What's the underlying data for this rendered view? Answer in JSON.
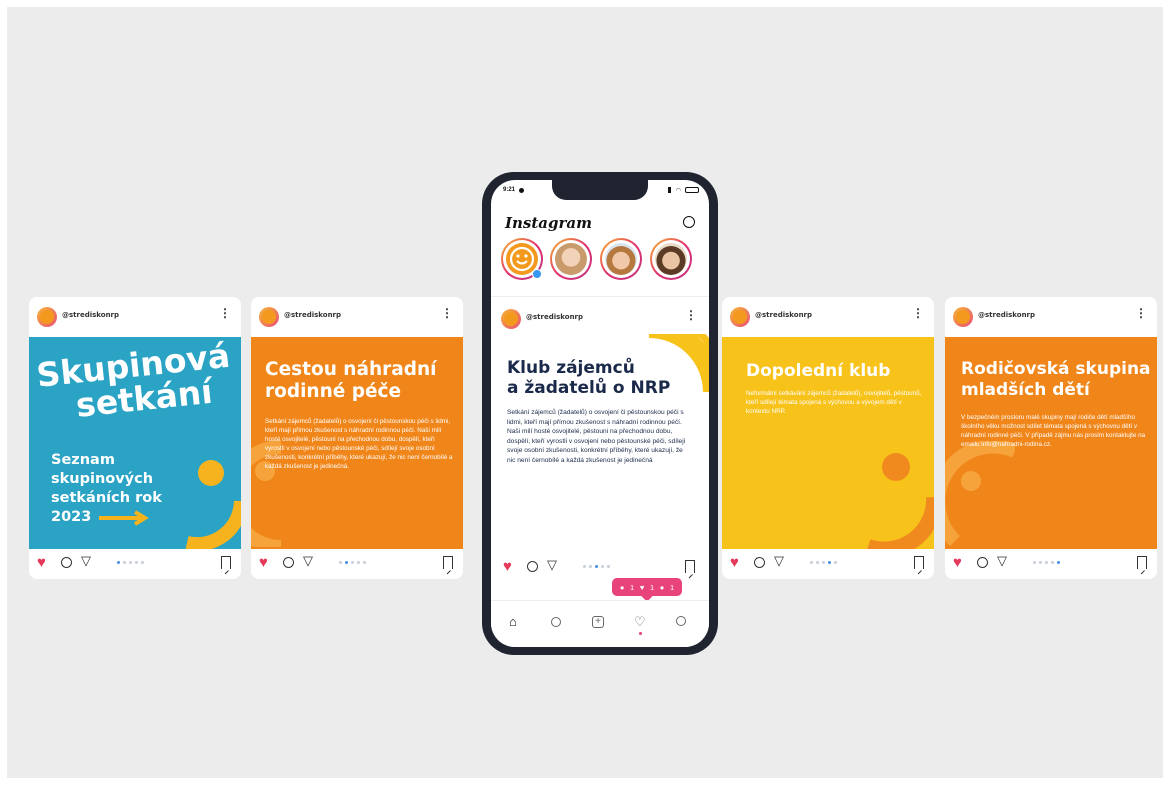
{
  "handle": "@strediskonrp",
  "menu_glyph": "⋮",
  "colors": {
    "background": "#ececec",
    "blue": "#2aa3c5",
    "orange": "#f0861a",
    "yellow": "#f7c21a",
    "navy": "#1b2a4a",
    "accent_pink": "#e8437b"
  },
  "cards": {
    "c1": {
      "title_line1": "Skupinová",
      "title_line2": "setkání",
      "subtitle_line1": "Seznam",
      "subtitle_line2": "skupinových",
      "subtitle_line3": "setkáních rok",
      "subtitle_line4": "2023"
    },
    "c2": {
      "title_line1": "Cestou náhradní",
      "title_line2": "rodinné péče",
      "body": "Setkání zájemců (žadatelů) o osvojení či pěstounskou péči s lidmi, kteří mají přímou zkušenost s náhradní rodinnou péčí. Naši milí hosté osvojitelé, pěstouni na přechodnou dobu, dospělí, kteří vyrostli v osvojení nebo pěstounské péči, sdílejí svoje osobní zkušenosti, konkrétní příběhy, které ukazují, že nic není černobílé a každá zkušenost je jedinečná."
    },
    "c4": {
      "title": "Dopolední klub",
      "body": "Neformální setkávání zájemců (žadatelů), osvojitelů, pěstounů, kteří sdílejí témata spojená s výchovou a vývojem dětí v kontextu NRP."
    },
    "c5": {
      "title_line1": "Rodičovská skupina",
      "title_line2": "mladších dětí",
      "body": "V bezpečném prostoru malé skupiny mají rodiče dětí mladšího školního věku možnost sdílet témata spojená s výchovou dětí v náhradní rodinné péči. V případě zájmu nás prosím kontaktujte na emailu info@nahradni-rodina.cz."
    }
  },
  "phone": {
    "time": "9:21",
    "app_title": "Instagram",
    "post": {
      "title_line1": "Klub zájemců",
      "title_line2": "a žadatelů o NRP",
      "body": "Setkání zájemců (žadatelů) o osvojení či pěstounskou péči s lidmi, kteří mají přímou zkušenost s náhradní rodinnou péčí. Naši milí hosté osvojitelé, pěstouni na přechodnou dobu, dospělí, kteří vyrostli v osvojení nebo pěstounské péči, sdílejí svoje osobní zkušenosti, konkrétní příběhy, které ukazují, že nic není černobílé a každá zkušenost je jedinečná"
    },
    "notifications": {
      "comments": "1",
      "likes": "1",
      "follows": "1"
    }
  },
  "icons": {
    "heart": "heart-icon",
    "comment": "comment-icon",
    "share": "send-icon",
    "save": "bookmark-icon",
    "home": "home-icon",
    "search": "search-icon",
    "add": "add-post-icon",
    "activity": "activity-icon",
    "profile": "profile-icon"
  }
}
